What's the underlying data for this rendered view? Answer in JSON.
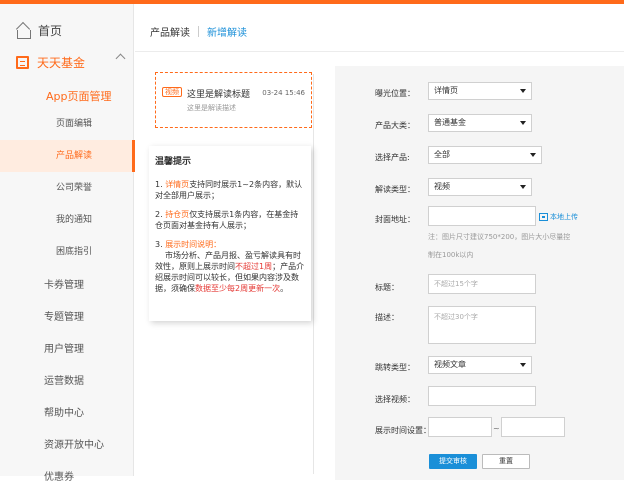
{
  "sidebar": {
    "home": "首页",
    "group": "天天基金",
    "sub_group": "App页面管理",
    "sub_items": [
      "页面编辑",
      "产品解读",
      "公司荣誉",
      "我的通知",
      "困底指引"
    ],
    "items": [
      "卡券管理",
      "专题管理",
      "用户管理",
      "运营数据",
      "帮助中心",
      "资源开放中心",
      "优惠券"
    ]
  },
  "tabs": {
    "tab1": "产品解读",
    "tab2": "新增解读"
  },
  "preview": {
    "tag": "视频",
    "title": "这里是解读标题",
    "time": "03-24  15:46",
    "desc": "这里是解读描述"
  },
  "tips": {
    "title": "温馨提示",
    "p1_a": "1. ",
    "p1_b": "详情页",
    "p1_c": "支持同时展示1~2条内容，默认对全部用户展示；",
    "p2_a": "2. ",
    "p2_b": "持仓页",
    "p2_c": "仅支持展示1条内容，在基金持仓页面对基金持有人展示；",
    "p3_a": "3. ",
    "p3_b": "展示时间说明：",
    "p3_c": "市场分析、产品月报、盈亏解读具有时效性，原则上展示时间",
    "p3_d": "不超过1周",
    "p3_e": "；产品介绍展示时间可以较长，但如果内容涉及数据，须确保",
    "p3_f": "数据至少每2周更新一次",
    "p3_g": "。"
  },
  "form": {
    "exposure_label": "曝光位置：",
    "exposure_value": "详情页",
    "product_type_label": "产品大类：",
    "product_type_value": "普通基金",
    "select_product_label": "选择产品:",
    "select_product_value": "全部",
    "interp_type_label": "解读类型：",
    "interp_type_value": "视频",
    "cover_label": "封面地址：",
    "upload_label": "本地上传",
    "cover_note1": "注：图片尺寸建议750*200，图片大小尽量控",
    "cover_note2": "制在100k以内",
    "title_label": "标题：",
    "title_placeholder": "不超过15个字",
    "desc_label": "描述：",
    "desc_placeholder": "不超过30个字",
    "jump_type_label": "跳转类型：",
    "jump_type_value": "视频文章",
    "select_video_label": "选择视频：",
    "display_time_label": "展示时间设置：",
    "tilde": "~",
    "submit": "提交审核",
    "reset": "重置"
  }
}
